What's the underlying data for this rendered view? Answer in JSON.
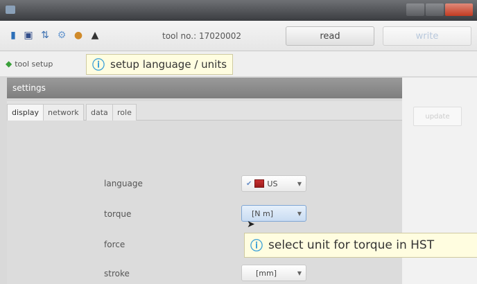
{
  "window": {
    "title": "",
    "controls": [
      "minimize",
      "maximize",
      "close"
    ]
  },
  "toolbar": {
    "icons": [
      "chart-icon",
      "save-icon",
      "transfer-icon",
      "settings-icon",
      "users-icon",
      "lock-icon"
    ],
    "tool_label": "tool no.: 17020002",
    "read_label": "read",
    "write_label": "write"
  },
  "setup_bar": {
    "tab_label": "tool setup"
  },
  "tooltips": {
    "toolbar_tip": "setup language / units",
    "torque_tip": "select unit for torque in HST"
  },
  "settings": {
    "header": "settings",
    "tabs": [
      "display",
      "network",
      "data",
      "role"
    ],
    "active_tab": "display",
    "right_button": "update"
  },
  "fields": {
    "language": {
      "label": "language",
      "value": "US"
    },
    "torque": {
      "label": "torque",
      "value": "[N m]"
    },
    "force": {
      "label": "force",
      "value": ""
    },
    "stroke": {
      "label": "stroke",
      "value": "[mm]"
    }
  },
  "colors": {
    "titlebar": "#4a4c50",
    "settings_header": "#8c8c8c",
    "tooltip_bg": "#fffde0",
    "info_icon": "#3aa0d8"
  }
}
